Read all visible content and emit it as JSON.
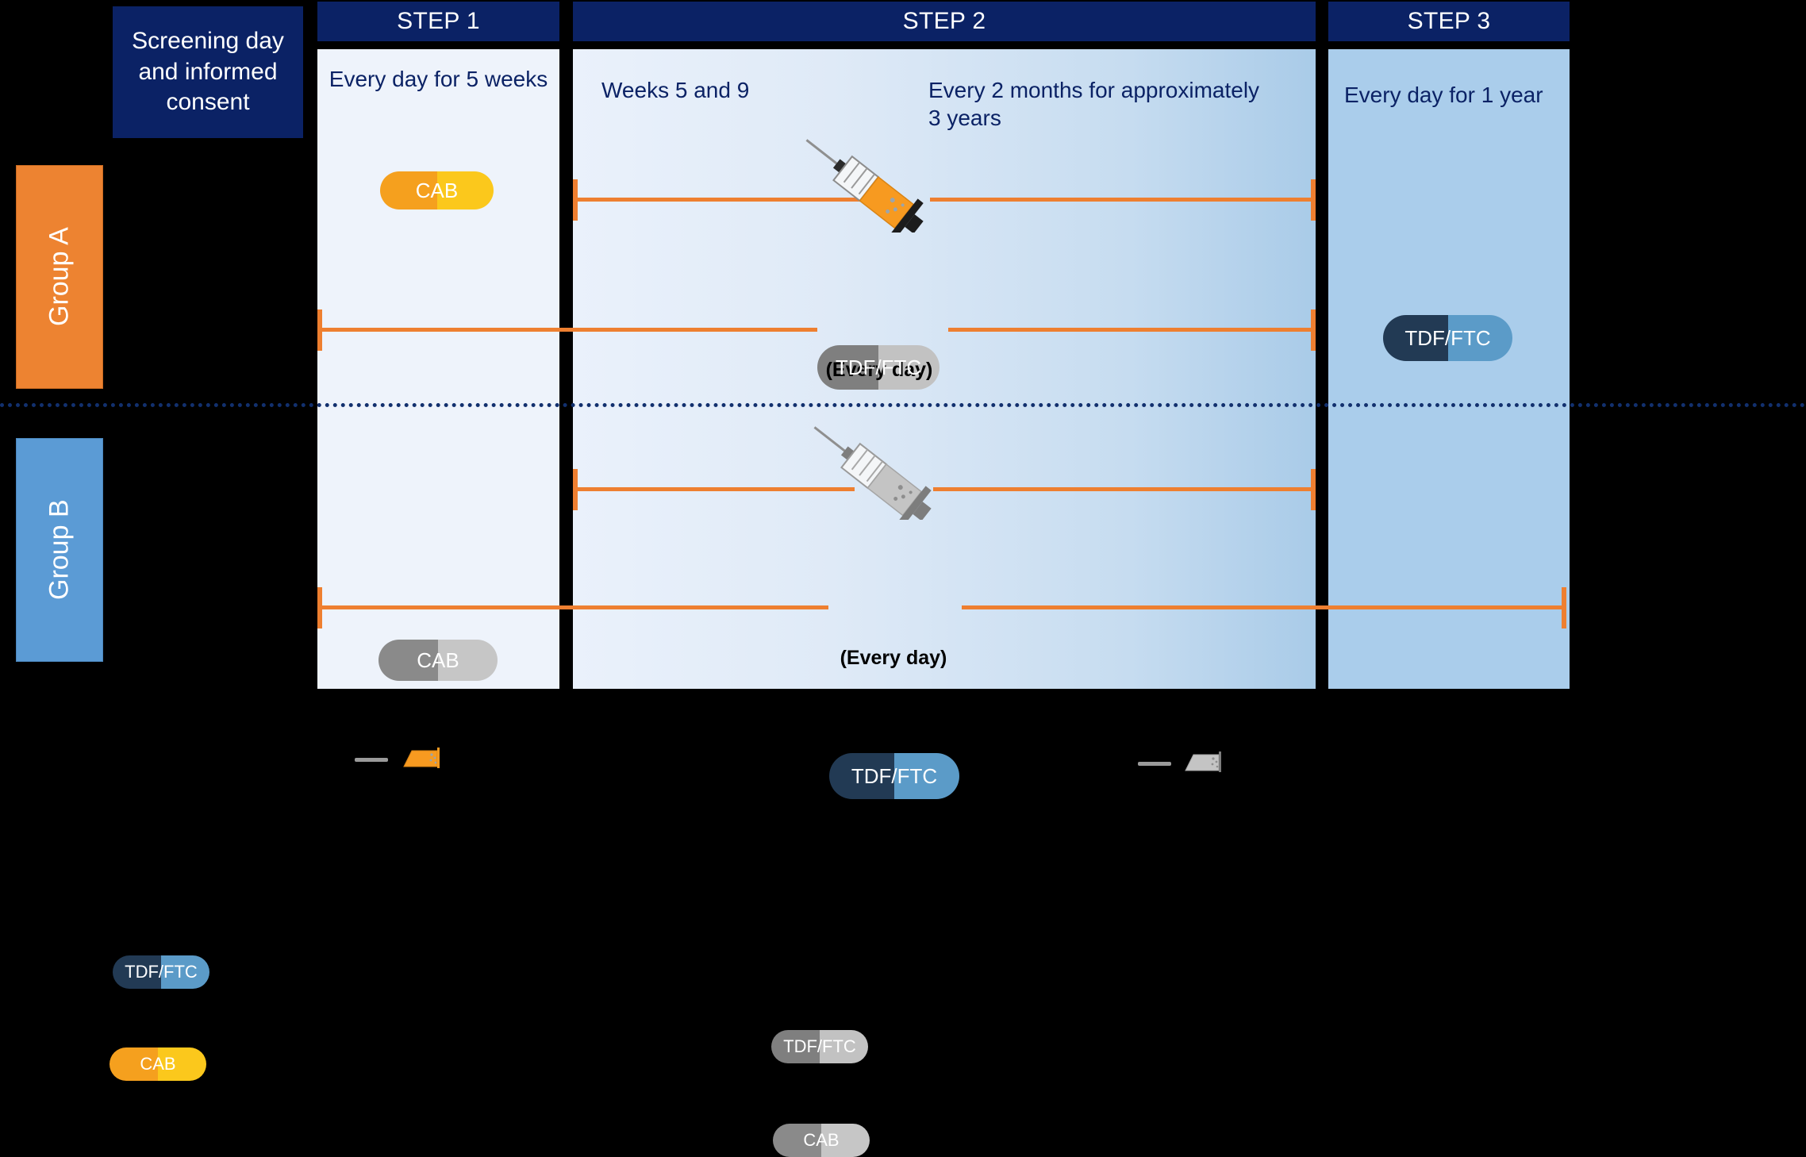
{
  "header": {
    "screening": "Screening day and informed consent",
    "steps": [
      {
        "label": "STEP 1"
      },
      {
        "label": "STEP 2"
      },
      {
        "label": "STEP 3"
      }
    ]
  },
  "captions": {
    "step1": "Every day for 5 weeks",
    "step2_left": "Weeks 5 and 9",
    "step2_right": "Every 2 months for approximately 3 years",
    "step3": "Every day for 1 year"
  },
  "groups": [
    {
      "id": "A",
      "label": "Group A",
      "color": "#ed8331"
    },
    {
      "id": "B",
      "label": "Group B",
      "color": "#5b9bd5"
    }
  ],
  "group_a": {
    "step1_pill": "CAB",
    "step1_pill_type": "active",
    "step2_injection": "active",
    "step2_pill": "TDF/FTC",
    "step2_pill_type": "placebo",
    "step2_frequency": "(Every day)",
    "step3_pill": "TDF/FTC",
    "step3_pill_type": "active"
  },
  "group_b": {
    "step1_pill": "CAB",
    "step1_pill_type": "placebo",
    "step2_injection": "placebo",
    "step2_pill": "TDF/FTC",
    "step2_pill_type": "active",
    "step2_frequency": "(Every day)"
  },
  "legend": {
    "active": {
      "pill_tdf": "TDF/FTC",
      "pill_cab": "CAB",
      "injection": "syringe-active"
    },
    "placebo": {
      "pill_tdf": "TDF/FTC",
      "pill_cab": "CAB",
      "injection": "syringe-placebo"
    }
  },
  "colors": {
    "navy": "#0b2265",
    "orange_accent": "#ee7f30",
    "group_a": "#ed8331",
    "group_b": "#5b9bd5",
    "tdf_active_left": "#223a54",
    "tdf_active_right": "#5b9bc8",
    "cab_active_left": "#f5a01e",
    "cab_active_right": "#fbc81c",
    "placebo_left": "#7f7f7f",
    "placebo_right": "#c2c2c2"
  }
}
